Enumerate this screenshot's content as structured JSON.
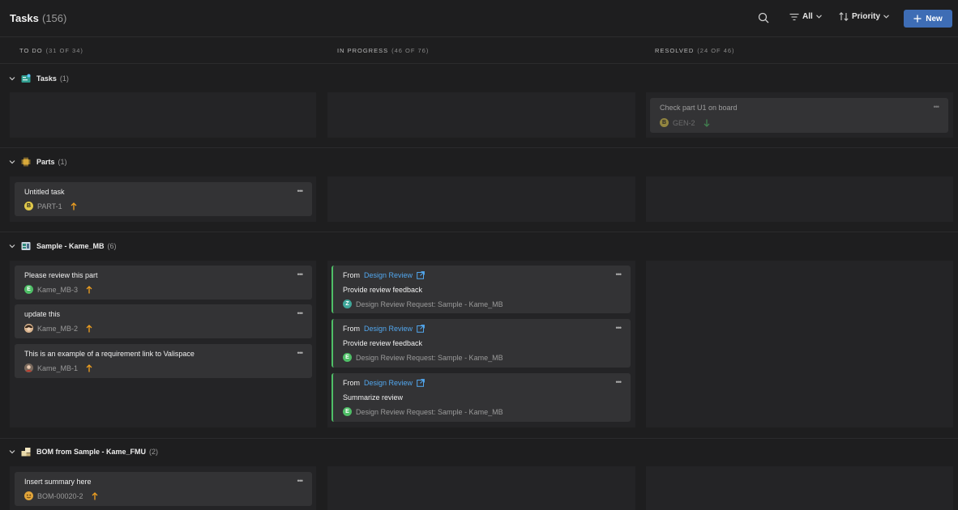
{
  "header": {
    "title": "Tasks",
    "count": "(156)",
    "filter_label": "All",
    "sort_label": "Priority",
    "new_label": "New"
  },
  "columns": [
    {
      "label": "TO DO",
      "sub": "(31 OF 34)"
    },
    {
      "label": "IN PROGRESS",
      "sub": "(46 OF 76)"
    },
    {
      "label": "RESOLVED",
      "sub": "(24 OF 46)"
    }
  ],
  "groups": [
    {
      "name": "Tasks",
      "count": "(1)"
    },
    {
      "name": "Parts",
      "count": "(1)"
    },
    {
      "name": "Sample - Kame_MB",
      "count": "(6)"
    },
    {
      "name": "BOM from Sample - Kame_FMU",
      "count": "(2)"
    }
  ],
  "cards": {
    "gen2": {
      "title": "Check part U1 on board",
      "avatar": "B",
      "id": "GEN-2"
    },
    "part1": {
      "title": "Untitled task",
      "avatar": "B",
      "id": "PART-1"
    },
    "mb3": {
      "title": "Please review this part",
      "avatar": "E",
      "id": "Kame_MB-3"
    },
    "mb2": {
      "title": "update this",
      "id": "Kame_MB-2"
    },
    "mb1": {
      "title": "This is an example of a requirement link to Valispace",
      "id": "Kame_MB-1"
    },
    "bom": {
      "title": "Insert summary here",
      "id": "BOM-00020-2"
    }
  },
  "reviews": [
    {
      "from": "From",
      "link": "Design Review",
      "title": "Provide review feedback",
      "avatar": "Z",
      "meta": "Design Review Request: Sample - Kame_MB"
    },
    {
      "from": "From",
      "link": "Design Review",
      "title": "Provide review feedback",
      "avatar": "E",
      "meta": "Design Review Request: Sample - Kame_MB"
    },
    {
      "from": "From",
      "link": "Design Review",
      "title": "Summarize review",
      "avatar": "E",
      "meta": "Design Review Request: Sample - Kame_MB"
    }
  ],
  "dots": "•••",
  "icons": {
    "search": "search-icon",
    "filter": "filter-icon",
    "sort": "sort-icon",
    "plus": "plus-icon",
    "chevron": "chevron-down-icon",
    "external": "external-link-icon",
    "priority_high": "arrow-up-icon",
    "priority_low": "arrow-down-icon"
  },
  "colors": {
    "accent": "#3e6db5",
    "link": "#52a7ee",
    "review_bar": "#4fbf67",
    "priority_high": "#f0a020",
    "priority_low": "#4fbf67"
  }
}
